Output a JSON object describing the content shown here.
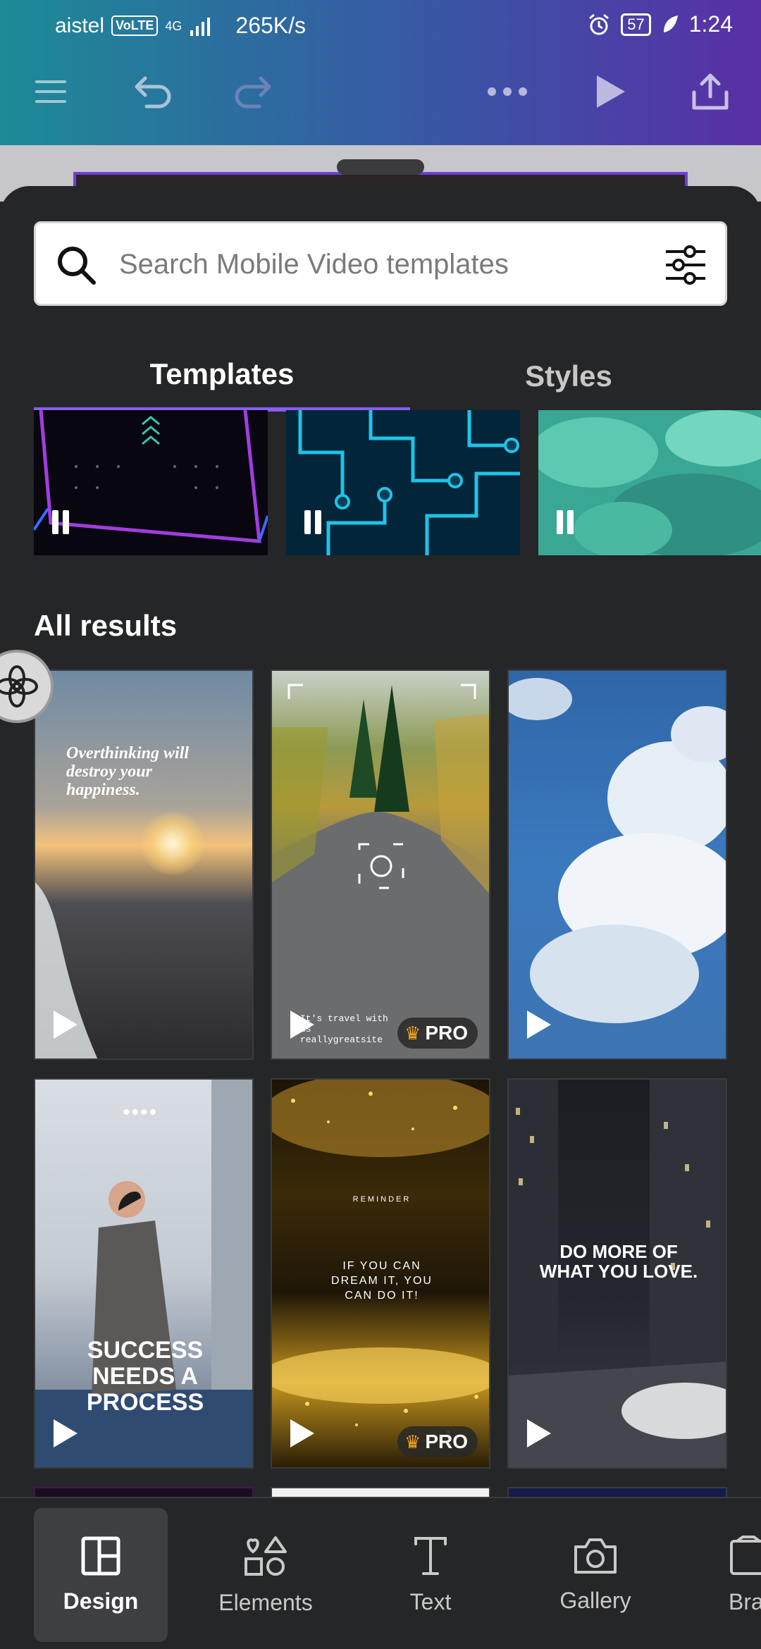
{
  "status_bar": {
    "carrier": "aistel",
    "volte": "VoLTE",
    "network": "4G",
    "speed": "265K/s",
    "battery": "57",
    "time": "1:24"
  },
  "toolbar": {
    "menu_icon": "hamburger-icon",
    "undo_icon": "undo-icon",
    "redo_icon": "redo-icon",
    "more_icon": "more-icon",
    "play_icon": "play-icon",
    "share_icon": "share-icon"
  },
  "search": {
    "placeholder": "Search Mobile Video templates"
  },
  "tabs": [
    {
      "label": "Templates",
      "active": true
    },
    {
      "label": "Styles",
      "active": false
    }
  ],
  "section": {
    "title": "All results"
  },
  "cards": [
    {
      "text": "Overthinking will destroy your happiness.",
      "pro": false
    },
    {
      "text": "It's travel with us reallygreatsite",
      "pro": true
    },
    {
      "text": "",
      "pro": false
    },
    {
      "text": "SUCCESS NEEDS A PROCESS",
      "pro": false
    },
    {
      "text_small": "REMINDER",
      "text": "IF YOU CAN DREAM IT, YOU CAN DO IT!",
      "pro": true
    },
    {
      "text": "DO MORE OF WHAT YOU LOVE.",
      "pro": false
    }
  ],
  "pro_label": "PRO",
  "bottom_nav": [
    {
      "label": "Design",
      "icon": "design-icon",
      "active": true
    },
    {
      "label": "Elements",
      "icon": "elements-icon",
      "active": false
    },
    {
      "label": "Text",
      "icon": "text-icon",
      "active": false
    },
    {
      "label": "Gallery",
      "icon": "camera-icon",
      "active": false
    },
    {
      "label": "Bra",
      "icon": "brand-icon",
      "active": false
    }
  ]
}
